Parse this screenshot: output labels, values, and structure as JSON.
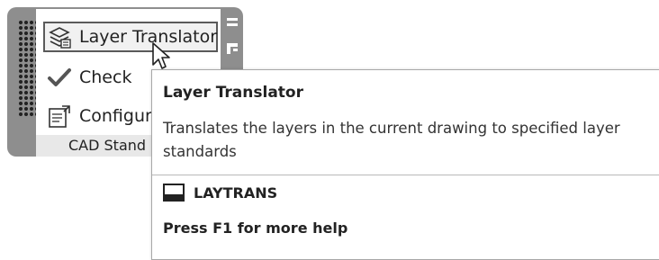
{
  "panel": {
    "title": "CAD Stand",
    "commands": [
      {
        "label": "Layer Translator",
        "icon": "layer-translator-icon"
      },
      {
        "label": "Check",
        "icon": "checkmark-icon"
      },
      {
        "label": "Configur",
        "icon": "configure-icon"
      }
    ]
  },
  "tooltip": {
    "title": "Layer Translator",
    "description": "Translates the layers in the current drawing to specified layer standards",
    "command_name": "LAYTRANS",
    "help_text": "Press F1 for more help"
  }
}
